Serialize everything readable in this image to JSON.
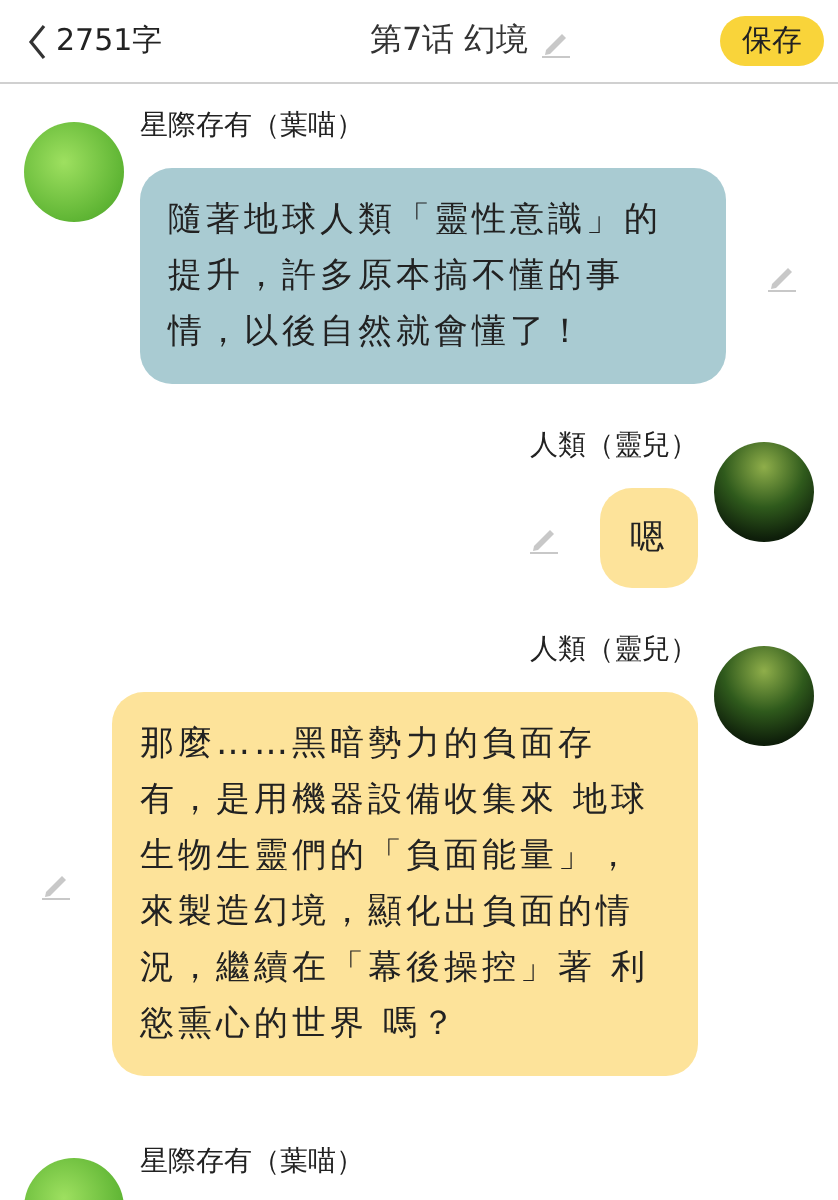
{
  "header": {
    "back_label": "2751字",
    "title": "第7话 幻境",
    "save_button": "保存"
  },
  "messages": [
    {
      "kind": "received",
      "name": "星際存有（葉喵）",
      "text": "隨著地球人類「靈性意識」的提升，許多原本搞不懂的事情，以後自然就會懂了！"
    },
    {
      "kind": "sent",
      "name": "人類（靈兒）",
      "text": "嗯"
    },
    {
      "kind": "sent",
      "name": "人類（靈兒）",
      "text": "那麼……黑暗勢力的負面存有，是用機器設備收集來 地球生物生靈們的「負面能量」，來製造幻境，顯化出負面的情況，繼續在「幕後操控」著 利慾熏心的世界 嗎？"
    },
    {
      "kind": "received",
      "name": "星際存有（葉喵）"
    }
  ]
}
